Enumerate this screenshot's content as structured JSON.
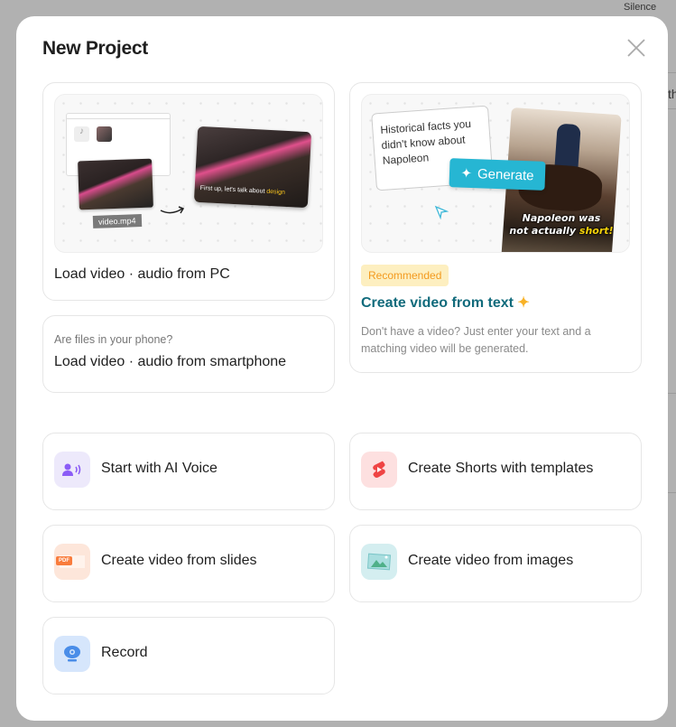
{
  "background": {
    "top_right_text": "Silence",
    "right_text": "th"
  },
  "modal": {
    "title": "New Project",
    "close_icon": "close-icon",
    "load_pc": {
      "label": "Load video · audio from PC",
      "file_chip": "video.mp4",
      "caption_start": "First up, let's talk about ",
      "caption_highlight": "design"
    },
    "load_phone": {
      "hint": "Are files in your phone?",
      "label": "Load video · audio from smartphone"
    },
    "text_to_video": {
      "prompt": "Historical facts you didn't know about Napoleon",
      "generate_label": "Generate",
      "image_caption_1": "Napoleon was",
      "image_caption_2": "not actually ",
      "image_caption_highlight": "short!",
      "badge": "Recommended",
      "title": "Create video from text",
      "description": "Don't have a video? Just enter your text and a matching video will be generated.",
      "accent": "#116b7c"
    },
    "actions": [
      {
        "label": "Start with AI Voice",
        "icon": "ai-voice-icon",
        "color": "#8b5cf6",
        "bg": "#ede9fb"
      },
      {
        "label": "Create Shorts with templates",
        "icon": "shorts-icon",
        "color": "#ef4444",
        "bg": "#fde0e0"
      },
      {
        "label": "Create video from slides",
        "icon": "pdf-slides-icon",
        "color": "#f97c3c",
        "bg": "#fde6da"
      },
      {
        "label": "Create video from images",
        "icon": "images-icon",
        "color": "#4fb089",
        "bg": "#d4eef0"
      },
      {
        "label": "Record",
        "icon": "webcam-icon",
        "color": "#4a8de8",
        "bg": "#d6e6fc"
      }
    ]
  }
}
